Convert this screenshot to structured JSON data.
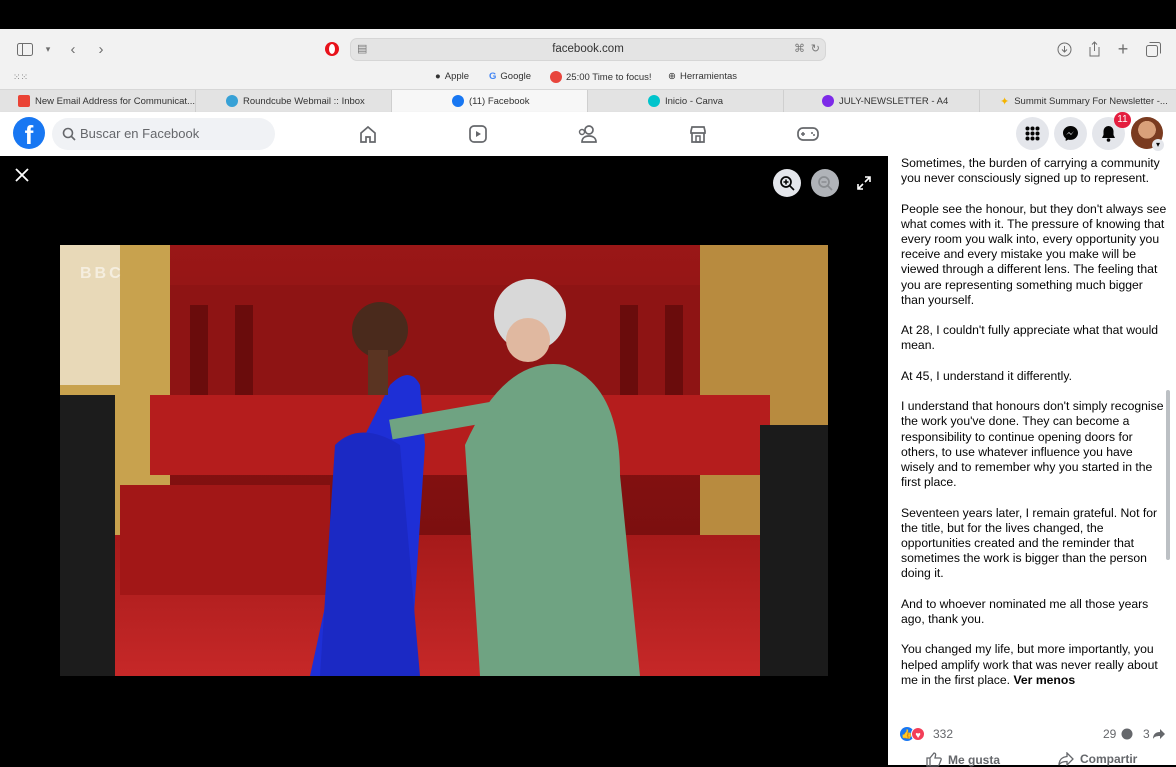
{
  "browser": {
    "url": "facebook.com",
    "bookmarks": [
      "Apple",
      "Google",
      "25:00 Time to focus!",
      "Herramientas"
    ],
    "tabs": [
      {
        "label": "New Email Address for Communicat...",
        "color": "#ea4335"
      },
      {
        "label": "Roundcube Webmail :: Inbox",
        "color": "#37a1d6"
      },
      {
        "label": "(11) Facebook",
        "color": "#1877f2"
      },
      {
        "label": "Inicio - Canva",
        "color": "#00c4cc"
      },
      {
        "label": "JULY-NEWSLETTER - A4",
        "color": "#7d2ae8"
      },
      {
        "label": "Summit Summary For Newsletter -...",
        "color": "#f4b400"
      }
    ]
  },
  "facebook": {
    "logo": "f",
    "search_placeholder": "Buscar en Facebook",
    "notifications_count": "11",
    "brand_color": "#1877f2"
  },
  "photo": {
    "watermark": "BBC"
  },
  "post": {
    "paragraphs": [
      "Sometimes, the burden of carrying a community you never consciously signed up to represent.",
      "People see the honour, but they don't always see what comes with it. The pressure of knowing that every room you walk into, every opportunity you receive and every mistake you make will be viewed through a different lens. The feeling that you are representing something much bigger than yourself.",
      "At 28, I couldn't fully appreciate what that would mean.",
      "At 45, I understand it differently.",
      "I understand that honours don't simply recognise the work you've done. They can become a responsibility to continue opening doors for others, to use whatever influence you have wisely and to remember why you started in the first place.",
      "Seventeen years later, I remain grateful. Not for the title, but for the lives changed, the opportunities created and the reminder that sometimes the work is bigger than the person doing it.",
      "And to whoever nominated me all those years ago, thank you."
    ],
    "last_paragraph": "You changed my life, but more importantly, you helped amplify work that was never really about me in the first place.",
    "see_less": "Ver menos",
    "reactions_count": "332",
    "comments_count": "29",
    "shares_count": "3",
    "like_label": "Me gusta",
    "share_label": "Compartir"
  }
}
